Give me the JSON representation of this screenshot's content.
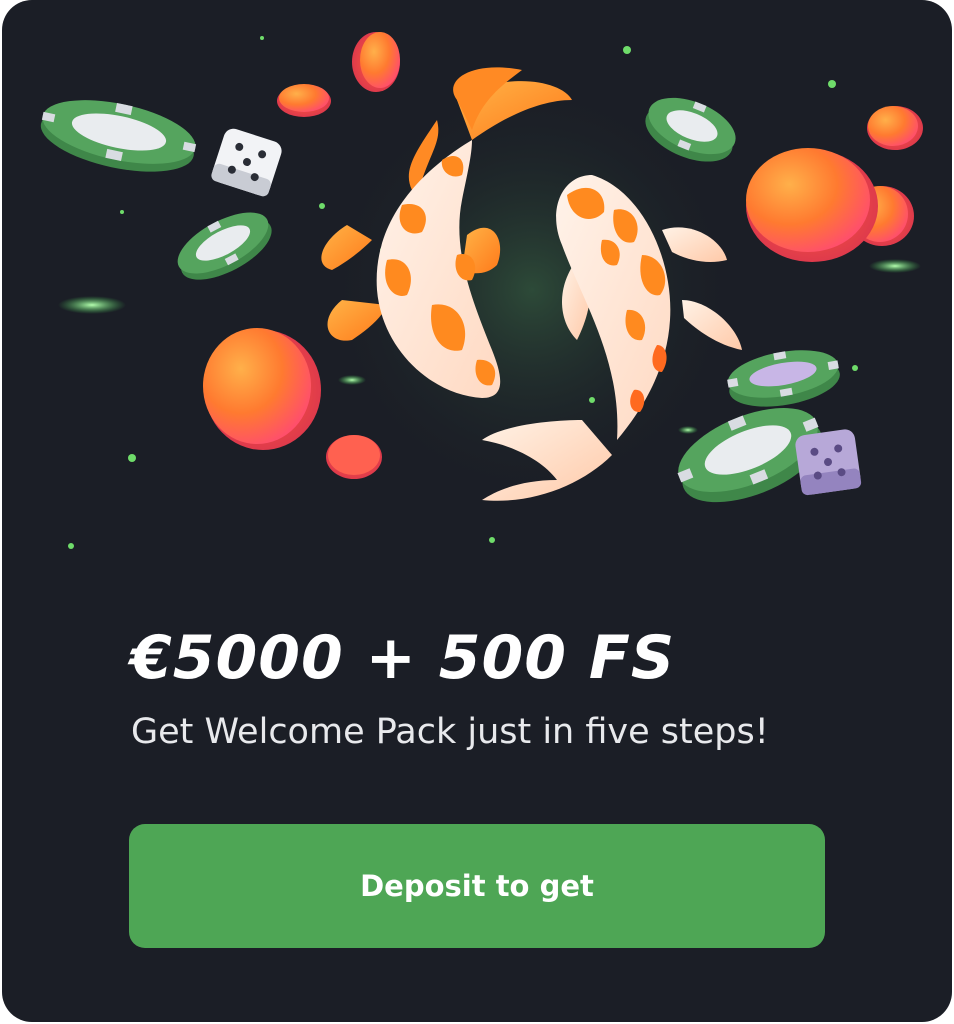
{
  "promo": {
    "headline": "€5000 + 500 FS",
    "subtitle": "Get Welcome Pack just in five steps!",
    "cta_label": "Deposit to get"
  },
  "colors": {
    "background": "#1b1e26",
    "button": "#4ea655",
    "coin": "#ff6a3a",
    "chip": "#4f9a57",
    "koi": "#f07a1e"
  },
  "illustration": {
    "icons": [
      "koi-fish-icon",
      "casino-chip-icon",
      "coin-icon",
      "dice-icon",
      "sparkle-icon"
    ]
  }
}
